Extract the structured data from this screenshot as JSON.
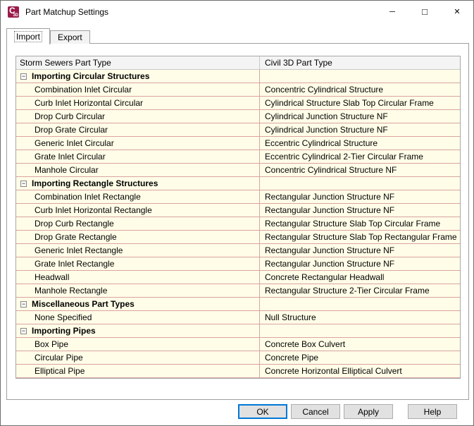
{
  "window": {
    "title": "Part Matchup Settings"
  },
  "icons": {
    "app_c": "C",
    "app_3d": "3D",
    "minimize": "─",
    "maximize": "□",
    "close": "✕",
    "collapse": "−"
  },
  "tabs": [
    {
      "label": "Import",
      "active": true
    },
    {
      "label": "Export",
      "active": false
    }
  ],
  "table": {
    "columns": [
      "Storm Sewers Part Type",
      "Civil 3D Part Type"
    ],
    "groups": [
      {
        "label": "Importing Circular Structures",
        "rows": [
          [
            "Combination Inlet Circular",
            "Concentric Cylindrical Structure"
          ],
          [
            "Curb Inlet Horizontal Circular",
            "Cylindrical Structure Slab Top Circular Frame"
          ],
          [
            "Drop Curb Circular",
            "Cylindrical Junction Structure NF"
          ],
          [
            "Drop Grate Circular",
            "Cylindrical Junction Structure NF"
          ],
          [
            "Generic Inlet Circular",
            "Eccentric Cylindrical Structure"
          ],
          [
            "Grate Inlet Circular",
            "Eccentric Cylindrical 2-Tier Circular Frame"
          ],
          [
            "Manhole Circular",
            "Concentric Cylindrical Structure NF"
          ]
        ]
      },
      {
        "label": "Importing Rectangle Structures",
        "rows": [
          [
            "Combination Inlet Rectangle",
            "Rectangular Junction Structure NF"
          ],
          [
            "Curb Inlet Horizontal Rectangle",
            "Rectangular Junction Structure NF"
          ],
          [
            "Drop Curb Rectangle",
            "Rectangular Structure Slab Top Circular Frame"
          ],
          [
            "Drop Grate Rectangle",
            "Rectangular Structure Slab Top Rectangular Frame"
          ],
          [
            "Generic Inlet Rectangle",
            "Rectangular Junction Structure NF"
          ],
          [
            "Grate Inlet Rectangle",
            "Rectangular Junction Structure NF"
          ],
          [
            "Headwall",
            "Concrete Rectangular Headwall"
          ],
          [
            "Manhole Rectangle",
            "Rectangular Structure 2-Tier Circular Frame"
          ]
        ]
      },
      {
        "label": "Miscellaneous Part Types",
        "rows": [
          [
            "None Specified",
            "Null Structure"
          ]
        ]
      },
      {
        "label": "Importing Pipes",
        "rows": [
          [
            "Box Pipe",
            "Concrete Box Culvert"
          ],
          [
            "Circular Pipe",
            "Concrete Pipe"
          ],
          [
            "Elliptical Pipe",
            "Concrete Horizontal Elliptical Culvert"
          ]
        ]
      }
    ]
  },
  "buttons": {
    "ok": "OK",
    "cancel": "Cancel",
    "apply": "Apply",
    "help": "Help"
  },
  "colors": {
    "accent": "#0078d7",
    "brand": "#9b1b4b",
    "row_bg": "#fffde7",
    "grid_line": "#d8a3a3",
    "header_bg": "#f4f4f4",
    "header_line": "#c9c9c9"
  }
}
